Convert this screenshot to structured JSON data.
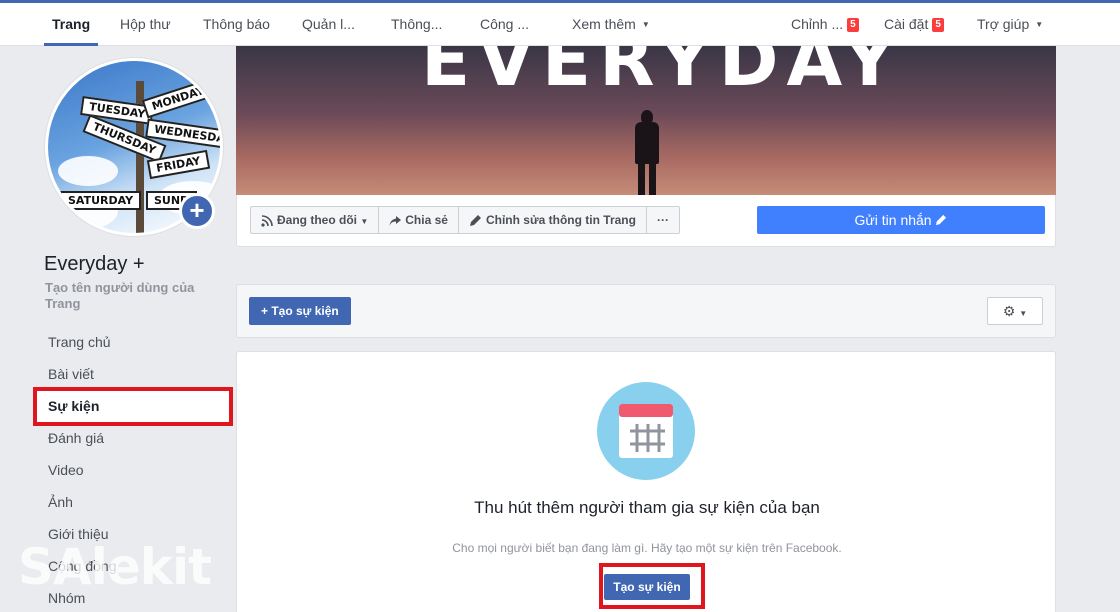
{
  "topnav": {
    "tabs": [
      {
        "label": "Trang"
      },
      {
        "label": "Hộp thư"
      },
      {
        "label": "Thông báo"
      },
      {
        "label": "Quản l..."
      },
      {
        "label": "Thông..."
      },
      {
        "label": "Công ..."
      },
      {
        "label": "Xem thêm"
      }
    ],
    "right": [
      {
        "label": "Chỉnh ...",
        "badge": "5"
      },
      {
        "label": "Cài đặt",
        "badge": "5"
      },
      {
        "label": "Trợ giúp"
      }
    ]
  },
  "profile": {
    "signs": [
      "TUESDAY",
      "MONDAY",
      "THURSDAY",
      "WEDNESDAY",
      "FRIDAY",
      "SATURDAY",
      "SUND"
    ],
    "page_name": "Everyday +",
    "username_hint": "Tạo tên người dùng của Trang"
  },
  "sidebar": {
    "items": [
      {
        "label": "Trang chủ"
      },
      {
        "label": "Bài viết"
      },
      {
        "label": "Sự kiện",
        "active": true
      },
      {
        "label": "Đánh giá"
      },
      {
        "label": "Video"
      },
      {
        "label": "Ảnh"
      },
      {
        "label": "Giới thiệu"
      },
      {
        "label": "Cộng đồng"
      },
      {
        "label": "Nhóm"
      }
    ]
  },
  "cover": {
    "title": "EVERYDAY"
  },
  "actions": {
    "following": "Đang theo dõi",
    "share": "Chia sẻ",
    "edit_info": "Chỉnh sửa thông tin Trang",
    "more": "···",
    "send_message": "Gửi tin nhắn"
  },
  "events": {
    "create_label": "+ Tạo sự kiện",
    "gear": "⚙"
  },
  "empty_state": {
    "title": "Thu hút thêm người tham gia sự kiện của bạn",
    "subtitle": "Cho mọi người biết bạn đang làm gì. Hãy tạo một sự kiện trên Facebook.",
    "cta": "Tạo sự kiện"
  },
  "watermark": "SAlekit",
  "colors": {
    "brand": "#4267b2",
    "message_button": "#4080ff",
    "highlight": "#e0161f",
    "badge": "#fa3e3e"
  }
}
